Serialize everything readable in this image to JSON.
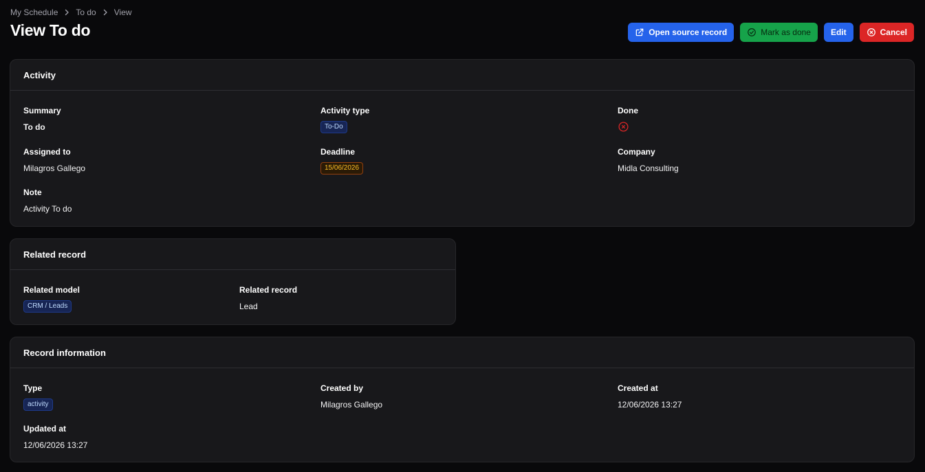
{
  "breadcrumb": [
    "My Schedule",
    "To do",
    "View"
  ],
  "page_title": "View To do",
  "actions": {
    "open_source": "Open source record",
    "mark_done": "Mark as done",
    "edit": "Edit",
    "cancel": "Cancel"
  },
  "activity": {
    "title": "Activity",
    "summary_label": "Summary",
    "summary_value": "To do",
    "activity_type_label": "Activity type",
    "activity_type_value": "To-Do",
    "done_label": "Done",
    "done_icon": "x-circle-icon",
    "assigned_label": "Assigned to",
    "assigned_value": "Milagros Gallego",
    "deadline_label": "Deadline",
    "deadline_value": "15/06/2026",
    "company_label": "Company",
    "company_value": "Midla Consulting",
    "note_label": "Note",
    "note_value": "Activity To do"
  },
  "related": {
    "title": "Related record",
    "model_label": "Related model",
    "model_value": "CRM / Leads",
    "record_label": "Related record",
    "record_value": "Lead"
  },
  "record_info": {
    "title": "Record information",
    "type_label": "Type",
    "type_value": "activity",
    "created_by_label": "Created by",
    "created_by_value": "Milagros Gallego",
    "created_at_label": "Created at",
    "created_at_value": "12/06/2026 13:27",
    "updated_at_label": "Updated at",
    "updated_at_value": "12/06/2026 13:27"
  },
  "colors": {
    "background": "#09090b",
    "card": "#18181b",
    "primary": "#2563eb",
    "success": "#16a34a",
    "danger": "#dc2626",
    "deadline_badge": "#fbbf24"
  }
}
